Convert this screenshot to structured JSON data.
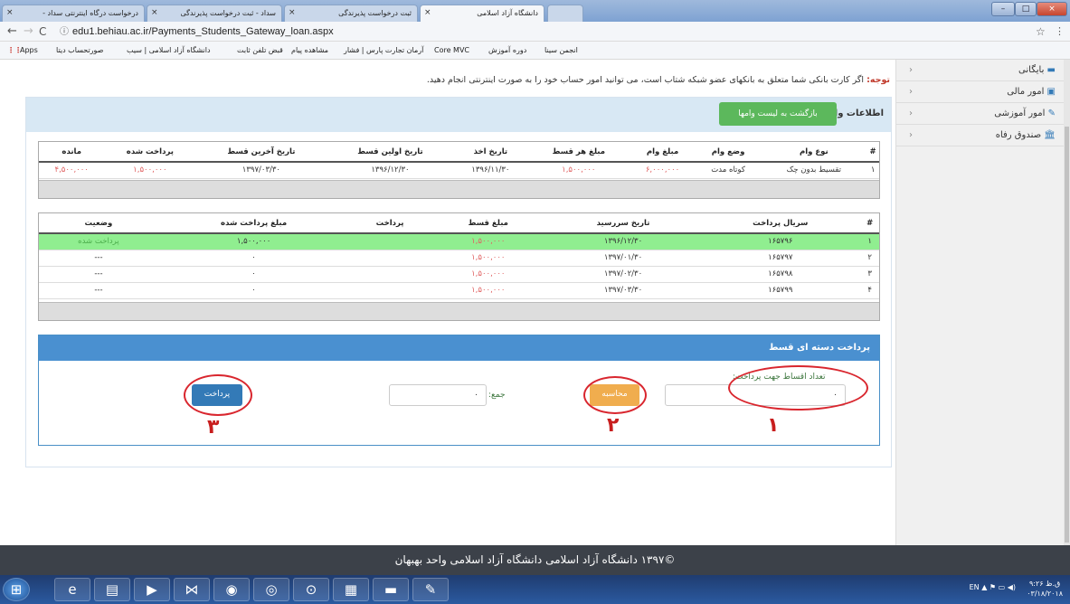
{
  "browser": {
    "tabs": [
      {
        "label": "درخواست درگاه اینترنتی سداد -",
        "active": false
      },
      {
        "label": "سداد - ثبت درخواست پذیرندگی",
        "active": false
      },
      {
        "label": "ثبت درخواست پذیرندگی",
        "active": false
      },
      {
        "label": "دانشگاه آزاد اسلامی",
        "active": true
      }
    ],
    "url": "edu1.behiau.ac.ir/Payments_Students_Gateway_loan.aspx",
    "bookmarks": [
      "Apps",
      "صورتحساب دیتا",
      "دانشگاه آزاد اسلامی | سیب",
      "مشاهده پیام",
      "قبض تلفن ثابت",
      "آرمان تجارت پارس | فشار",
      "Core MVC",
      "دوره آموزش",
      "انجمن سینا"
    ]
  },
  "sidebar": {
    "items": [
      {
        "label": "بایگانی",
        "icon": "archive-icon"
      },
      {
        "label": "امور مالی",
        "icon": "money-icon"
      },
      {
        "label": "امور آموزشی",
        "icon": "pencil-icon"
      },
      {
        "label": "صندوق رفاه",
        "icon": "bank-icon"
      }
    ]
  },
  "notice": {
    "bold": "توجه:",
    "text": " اگر کارت بانکی شما متعلق به بانکهای عضو شبکه شتاب است، می توانید امور حساب خود را به صورت اینترنتی انجام دهید."
  },
  "loan_panel": {
    "title": "اطلاعات وام",
    "back_button": "بازگشت به لیست وامها"
  },
  "loans_table": {
    "headers": [
      "#",
      "نوع وام",
      "وضع وام",
      "مبلغ وام",
      "مبلغ هر قسط",
      "تاریخ اخذ",
      "تاریخ اولین قسط",
      "تاریخ آخرین قسط",
      "پرداخت شده",
      "مانده"
    ],
    "rows": [
      [
        "۱",
        "تقسیط بدون چک",
        "کوتاه مدت",
        "۶,۰۰۰,۰۰۰",
        "۱,۵۰۰,۰۰۰",
        "۱۳۹۶/۱۱/۳۰",
        "۱۳۹۶/۱۲/۳۰",
        "۱۳۹۷/۰۳/۳۰",
        "۱,۵۰۰,۰۰۰",
        "۴,۵۰۰,۰۰۰"
      ]
    ]
  },
  "installments_table": {
    "headers": [
      "#",
      "سریال پرداخت",
      "تاریخ سررسید",
      "مبلغ قسط",
      "پرداخت",
      "مبلغ پرداخت شده",
      "وضعیت"
    ],
    "rows": [
      [
        "۱",
        "۱۶۵۷۹۶",
        "۱۳۹۶/۱۲/۳۰",
        "۱,۵۰۰,۰۰۰",
        "",
        "۱,۵۰۰,۰۰۰",
        "پرداخت شده"
      ],
      [
        "۲",
        "۱۶۵۷۹۷",
        "۱۳۹۷/۰۱/۳۰",
        "۱,۵۰۰,۰۰۰",
        "",
        "۰",
        "---"
      ],
      [
        "۳",
        "۱۶۵۷۹۸",
        "۱۳۹۷/۰۲/۳۰",
        "۱,۵۰۰,۰۰۰",
        "",
        "۰",
        "---"
      ],
      [
        "۴",
        "۱۶۵۷۹۹",
        "۱۳۹۷/۰۳/۳۰",
        "۱,۵۰۰,۰۰۰",
        "",
        "۰",
        "---"
      ]
    ]
  },
  "group_payment": {
    "title": "پرداخت دسته ای قسط",
    "count_label": "تعداد اقساط جهت پرداخت:",
    "count_value": "۰",
    "calculate_button": "محاسبه",
    "sum_label": "جمع:",
    "sum_value": "۰",
    "pay_button": "پرداخت",
    "annotations": [
      "۱",
      "۲",
      "۳"
    ]
  },
  "footer": {
    "text": "©۱۳۹۷ دانشگاه آزاد اسلامی دانشگاه آزاد اسلامی واحد بهبهان"
  },
  "taskbar": {
    "lang": "EN",
    "time": "۹:۲۶ ق.ظ",
    "date": "۰۳/۱۸/۲۰۱۸"
  },
  "colors": {
    "paid_row": "#90ee90",
    "panel_blue": "#4a90d0",
    "annotation_red": "#d9262e"
  }
}
